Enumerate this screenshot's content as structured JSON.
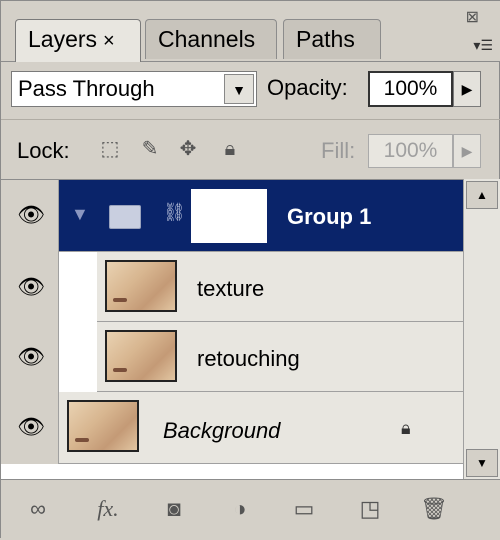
{
  "tabs": [
    {
      "label": "Layers",
      "close": "×"
    },
    {
      "label": "Channels"
    },
    {
      "label": "Paths"
    }
  ],
  "blend_mode": "Pass Through",
  "opacity_label": "Opacity:",
  "opacity_value": "100%",
  "lock_label": "Lock:",
  "fill_label": "Fill:",
  "fill_value": "100%",
  "layers": [
    {
      "name": "Group 1",
      "type": "group",
      "visible": true
    },
    {
      "name": "texture",
      "type": "layer",
      "visible": true
    },
    {
      "name": "retouching",
      "type": "layer",
      "visible": true
    },
    {
      "name": "Background",
      "type": "background",
      "visible": true,
      "locked": true
    }
  ],
  "colors": {
    "selection": "#0a246a",
    "panel": "#d4d0c8"
  },
  "icons": {
    "eye": "eye-icon",
    "lock_transparent": "lock-transparent-icon",
    "lock_image": "lock-image-icon",
    "lock_position": "lock-position-icon",
    "lock_all": "lock-all-icon",
    "toolbar": [
      "link-icon",
      "fx-icon",
      "mask-icon",
      "adjustment-icon",
      "group-folder-icon",
      "new-layer-icon",
      "trash-icon"
    ]
  }
}
